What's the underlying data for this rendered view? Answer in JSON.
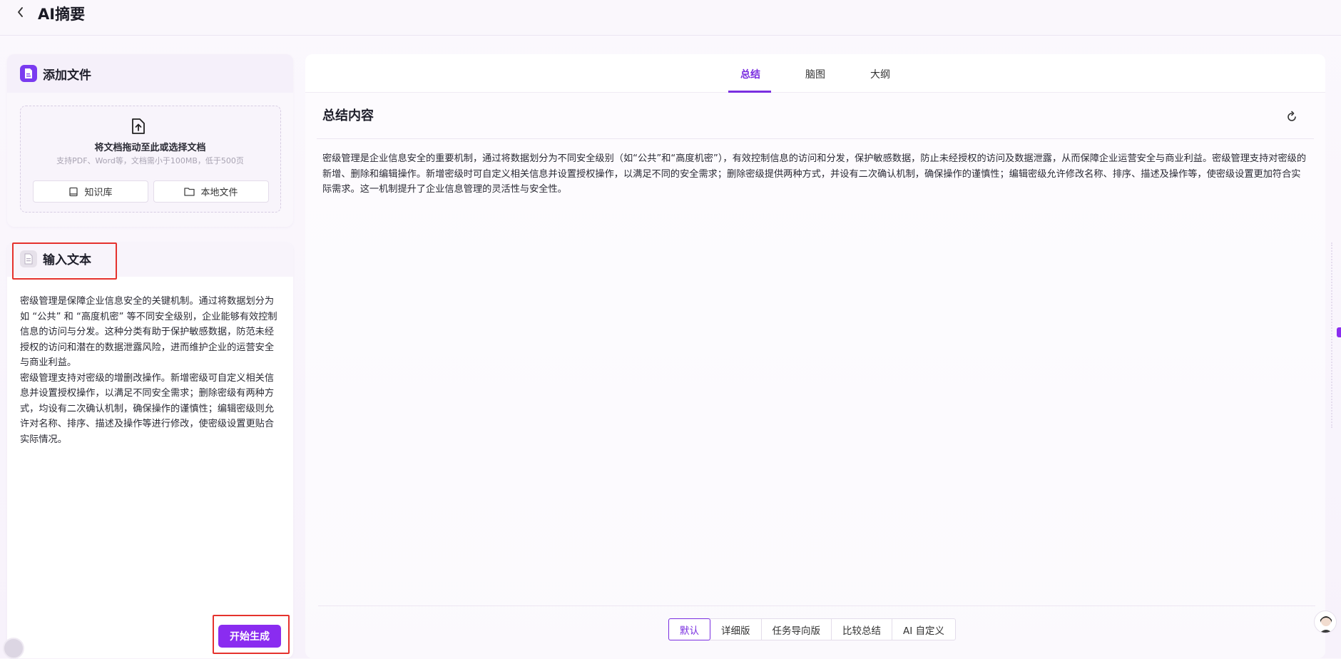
{
  "header": {
    "title": "AI摘要"
  },
  "add_file": {
    "title": "添加文件",
    "drop_title": "将文档拖动至此或选择文档",
    "drop_sub": "支持PDF、Word等，文档需小于100MB，低于500页",
    "kb_button": "知识库",
    "local_button": "本地文件"
  },
  "input_text": {
    "title": "输入文本",
    "content": "密级管理是保障企业信息安全的关键机制。通过将数据划分为如 “公共” 和 “高度机密” 等不同安全级别，企业能够有效控制信息的访问与分发。这种分类有助于保护敏感数据，防范未经授权的访问和潜在的数据泄露风险，进而维护企业的运营安全与商业利益。\n密级管理支持对密级的增删改操作。新增密级可自定义相关信息并设置授权操作，以满足不同安全需求；删除密级有两种方式，均设有二次确认机制，确保操作的谨慎性；编辑密级则允许对名称、排序、描述及操作等进行修改，使密级设置更贴合实际情况。",
    "generate_button": "开始生成"
  },
  "tabs": [
    {
      "label": "总结",
      "active": true
    },
    {
      "label": "脑图",
      "active": false
    },
    {
      "label": "大纲",
      "active": false
    }
  ],
  "summary": {
    "title": "总结内容",
    "content": "密级管理是企业信息安全的重要机制，通过将数据划分为不同安全级别（如“公共”和“高度机密”），有效控制信息的访问和分发，保护敏感数据，防止未经授权的访问及数据泄露，从而保障企业运营安全与商业利益。密级管理支持对密级的新增、删除和编辑操作。新增密级时可自定义相关信息并设置授权操作，以满足不同的安全需求；删除密级提供两种方式，并设有二次确认机制，确保操作的谨慎性；编辑密级允许修改名称、排序、描述及操作等，使密级设置更加符合实际需求。这一机制提升了企业信息管理的灵活性与安全性。"
  },
  "styles": [
    {
      "label": "默认",
      "active": true
    },
    {
      "label": "详细版",
      "active": false
    },
    {
      "label": "任务导向版",
      "active": false
    },
    {
      "label": "比较总结",
      "active": false
    },
    {
      "label": "AI 自定义",
      "active": false
    }
  ],
  "colors": {
    "accent": "#7a2ee0",
    "button": "#8a2cf0",
    "highlight_border": "#e5322d"
  }
}
